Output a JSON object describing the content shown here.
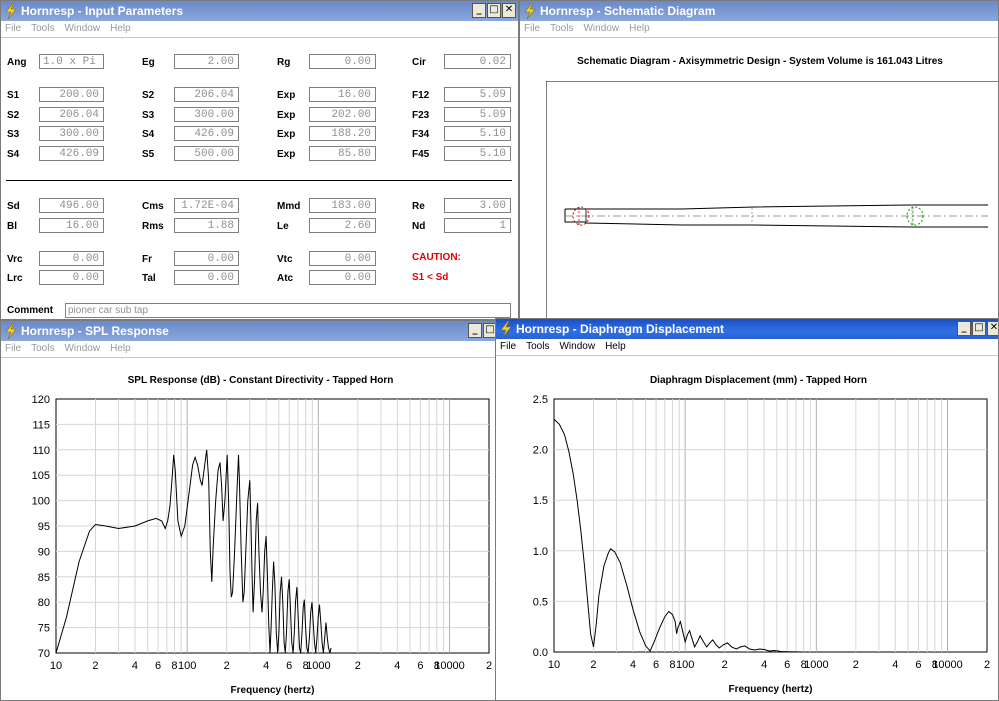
{
  "input_window": {
    "title": "Hornresp - Input Parameters",
    "menu": [
      "File",
      "Tools",
      "Window",
      "Help"
    ],
    "controls": [
      "_",
      "□",
      "✕"
    ],
    "rows": [
      [
        {
          "label": "Ang",
          "value": "1.0 x Pi"
        },
        {
          "label": "Eg",
          "value": "2.00"
        },
        {
          "label": "Rg",
          "value": "0.00"
        },
        {
          "label": "Cir",
          "value": "0.02"
        }
      ],
      [
        {
          "label": "S1",
          "value": "200.00"
        },
        {
          "label": "S2",
          "value": "206.04"
        },
        {
          "label": "Exp",
          "value": "16.00"
        },
        {
          "label": "F12",
          "value": "5.09"
        }
      ],
      [
        {
          "label": "S2",
          "value": "206.04"
        },
        {
          "label": "S3",
          "value": "300.00"
        },
        {
          "label": "Exp",
          "value": "202.00"
        },
        {
          "label": "F23",
          "value": "5.09"
        }
      ],
      [
        {
          "label": "S3",
          "value": "300.00"
        },
        {
          "label": "S4",
          "value": "426.09"
        },
        {
          "label": "Exp",
          "value": "188.20"
        },
        {
          "label": "F34",
          "value": "5.10"
        }
      ],
      [
        {
          "label": "S4",
          "value": "426.09"
        },
        {
          "label": "S5",
          "value": "500.00"
        },
        {
          "label": "Exp",
          "value": "85.80"
        },
        {
          "label": "F45",
          "value": "5.10"
        }
      ],
      [
        {
          "label": "Sd",
          "value": "496.00"
        },
        {
          "label": "Cms",
          "value": "1.72E-04"
        },
        {
          "label": "Mmd",
          "value": "183.00"
        },
        {
          "label": "Re",
          "value": "3.00"
        }
      ],
      [
        {
          "label": "Bl",
          "value": "16.00"
        },
        {
          "label": "Rms",
          "value": "1.88"
        },
        {
          "label": "Le",
          "value": "2.60"
        },
        {
          "label": "Nd",
          "value": "1"
        }
      ],
      [
        {
          "label": "Vrc",
          "value": "0.00"
        },
        {
          "label": "Fr",
          "value": "0.00"
        },
        {
          "label": "Vtc",
          "value": "0.00"
        }
      ],
      [
        {
          "label": "Lrc",
          "value": "0.00"
        },
        {
          "label": "Tal",
          "value": "0.00"
        },
        {
          "label": "Atc",
          "value": "0.00"
        }
      ]
    ],
    "caution_title": "CAUTION:",
    "caution_text": "S1 < Sd",
    "comment_label": "Comment",
    "comment_value": "pioner car sub tap",
    "colors": {
      "caution": "#e00000"
    }
  },
  "schematic_window": {
    "title": "Hornresp - Schematic Diagram",
    "menu": [
      "File",
      "Tools",
      "Window",
      "Help"
    ],
    "heading": "Schematic Diagram - Axisymmetric Design - System Volume is 161.043 Litres"
  },
  "spl_window": {
    "title": "Hornresp - SPL Response",
    "menu": [
      "File",
      "Tools",
      "Window",
      "Help"
    ],
    "controls": [
      "_",
      "□"
    ]
  },
  "disp_window": {
    "title": "Hornresp - Diaphragm Displacement",
    "menu": [
      "File",
      "Tools",
      "Window",
      "Help"
    ],
    "controls": [
      "_",
      "□",
      "✕"
    ]
  },
  "chart_data": [
    {
      "type": "line",
      "title": "SPL Response (dB) - Constant Directivity - Tapped Horn",
      "xlabel": "Frequency (hertz)",
      "ylabel": "",
      "xscale": "log",
      "xlim": [
        10,
        20000
      ],
      "ylim": [
        70,
        120
      ],
      "yticks": [
        70,
        75,
        80,
        85,
        90,
        95,
        100,
        105,
        110,
        115,
        120
      ],
      "xtick_labels": [
        {
          "x": 10,
          "t": "10"
        },
        {
          "x": 20,
          "t": "2"
        },
        {
          "x": 40,
          "t": "4"
        },
        {
          "x": 60,
          "t": "6"
        },
        {
          "x": 80,
          "t": "8"
        },
        {
          "x": 100,
          "t": "100"
        },
        {
          "x": 200,
          "t": "2"
        },
        {
          "x": 400,
          "t": "4"
        },
        {
          "x": 600,
          "t": "6"
        },
        {
          "x": 800,
          "t": "8"
        },
        {
          "x": 1000,
          "t": "1000"
        },
        {
          "x": 2000,
          "t": "2"
        },
        {
          "x": 4000,
          "t": "4"
        },
        {
          "x": 6000,
          "t": "6"
        },
        {
          "x": 8000,
          "t": "8"
        },
        {
          "x": 10000,
          "t": "10000"
        },
        {
          "x": 20000,
          "t": "2"
        }
      ],
      "grid": true,
      "series": [
        {
          "values": [
            [
              10,
              70
            ],
            [
              12,
              77
            ],
            [
              15,
              88
            ],
            [
              18,
              94
            ],
            [
              20,
              95.3
            ],
            [
              24,
              95
            ],
            [
              30,
              94.5
            ],
            [
              40,
              95
            ],
            [
              50,
              96
            ],
            [
              58,
              96.5
            ],
            [
              64,
              96
            ],
            [
              68,
              94.5
            ],
            [
              71,
              96
            ],
            [
              74,
              99
            ],
            [
              77,
              105
            ],
            [
              79,
              109
            ],
            [
              81,
              106
            ],
            [
              85,
              96
            ],
            [
              90,
              93
            ],
            [
              96,
              95
            ],
            [
              104,
              102
            ],
            [
              110,
              107
            ],
            [
              115,
              108.5
            ],
            [
              120,
              107
            ],
            [
              126,
              104
            ],
            [
              130,
              103
            ],
            [
              136,
              107
            ],
            [
              141,
              110
            ],
            [
              146,
              104
            ],
            [
              150,
              90
            ],
            [
              154,
              84
            ],
            [
              158,
              91
            ],
            [
              165,
              100
            ],
            [
              172,
              106
            ],
            [
              178,
              107.5
            ],
            [
              183,
              103
            ],
            [
              188,
              96
            ],
            [
              194,
              100
            ],
            [
              202,
              109
            ],
            [
              207,
              100
            ],
            [
              212,
              86
            ],
            [
              217,
              81
            ],
            [
              222,
              82
            ],
            [
              230,
              90
            ],
            [
              240,
              102
            ],
            [
              246,
              109
            ],
            [
              250,
              104
            ],
            [
              258,
              90
            ],
            [
              266,
              80
            ],
            [
              272,
              82
            ],
            [
              280,
              90
            ],
            [
              290,
              100
            ],
            [
              300,
              104
            ],
            [
              306,
              96
            ],
            [
              312,
              86
            ],
            [
              318,
              78
            ],
            [
              326,
              84
            ],
            [
              336,
              96
            ],
            [
              344,
              99.5
            ],
            [
              352,
              90
            ],
            [
              362,
              82
            ],
            [
              372,
              78
            ],
            [
              380,
              82
            ],
            [
              390,
              90
            ],
            [
              400,
              93
            ],
            [
              408,
              86
            ],
            [
              418,
              76
            ],
            [
              428,
              70
            ],
            [
              436,
              75
            ],
            [
              446,
              82
            ],
            [
              456,
              88
            ],
            [
              466,
              84
            ],
            [
              478,
              74
            ],
            [
              490,
              70
            ],
            [
              500,
              74
            ],
            [
              512,
              82
            ],
            [
              524,
              85
            ],
            [
              536,
              80
            ],
            [
              548,
              72
            ],
            [
              560,
              70
            ],
            [
              572,
              74
            ],
            [
              586,
              82
            ],
            [
              600,
              84.5
            ],
            [
              614,
              78
            ],
            [
              628,
              72
            ],
            [
              642,
              70
            ],
            [
              656,
              74
            ],
            [
              670,
              80
            ],
            [
              686,
              83
            ],
            [
              702,
              77
            ],
            [
              718,
              71
            ],
            [
              734,
              70
            ],
            [
              750,
              74
            ],
            [
              766,
              79
            ],
            [
              782,
              80.5
            ],
            [
              800,
              75
            ],
            [
              818,
              71
            ],
            [
              836,
              70
            ],
            [
              854,
              73
            ],
            [
              874,
              78
            ],
            [
              894,
              80
            ],
            [
              914,
              76
            ],
            [
              934,
              72
            ],
            [
              954,
              70
            ],
            [
              976,
              73
            ],
            [
              998,
              77
            ],
            [
              1020,
              79.5
            ],
            [
              1044,
              76
            ],
            [
              1068,
              72
            ],
            [
              1092,
              70
            ],
            [
              1118,
              73
            ],
            [
              1144,
              76
            ],
            [
              1170,
              73
            ],
            [
              1196,
              71
            ],
            [
              1224,
              70
            ],
            [
              1250,
              71
            ]
          ]
        }
      ]
    },
    {
      "type": "line",
      "title": "Diaphragm Displacement (mm) - Tapped Horn",
      "xlabel": "Frequency (hertz)",
      "ylabel": "",
      "xscale": "log",
      "xlim": [
        10,
        20000
      ],
      "ylim": [
        0,
        2.5
      ],
      "yticks": [
        0.0,
        0.5,
        1.0,
        1.5,
        2.0,
        2.5
      ],
      "ytick_labels": [
        "0.0",
        "0.5",
        "1.0",
        "1.5",
        "2.0",
        "2.5"
      ],
      "xtick_labels": [
        {
          "x": 10,
          "t": "10"
        },
        {
          "x": 20,
          "t": "2"
        },
        {
          "x": 40,
          "t": "4"
        },
        {
          "x": 60,
          "t": "6"
        },
        {
          "x": 80,
          "t": "8"
        },
        {
          "x": 100,
          "t": "100"
        },
        {
          "x": 200,
          "t": "2"
        },
        {
          "x": 400,
          "t": "4"
        },
        {
          "x": 600,
          "t": "6"
        },
        {
          "x": 800,
          "t": "8"
        },
        {
          "x": 1000,
          "t": "1000"
        },
        {
          "x": 2000,
          "t": "2"
        },
        {
          "x": 4000,
          "t": "4"
        },
        {
          "x": 6000,
          "t": "6"
        },
        {
          "x": 8000,
          "t": "8"
        },
        {
          "x": 10000,
          "t": "10000"
        },
        {
          "x": 20000,
          "t": "2"
        }
      ],
      "grid": true,
      "series": [
        {
          "values": [
            [
              10,
              2.3
            ],
            [
              11,
              2.25
            ],
            [
              12,
              2.15
            ],
            [
              13,
              1.98
            ],
            [
              14,
              1.76
            ],
            [
              15,
              1.5
            ],
            [
              16,
              1.2
            ],
            [
              17,
              0.88
            ],
            [
              18,
              0.52
            ],
            [
              19,
              0.18
            ],
            [
              20,
              0.05
            ],
            [
              21,
              0.28
            ],
            [
              22,
              0.56
            ],
            [
              24,
              0.85
            ],
            [
              26,
              0.98
            ],
            [
              27,
              1.02
            ],
            [
              29,
              0.99
            ],
            [
              32,
              0.88
            ],
            [
              36,
              0.65
            ],
            [
              40,
              0.42
            ],
            [
              45,
              0.2
            ],
            [
              50,
              0.06
            ],
            [
              54,
              0.01
            ],
            [
              58,
              0.1
            ],
            [
              64,
              0.24
            ],
            [
              70,
              0.35
            ],
            [
              75,
              0.4
            ],
            [
              80,
              0.37
            ],
            [
              84,
              0.3
            ],
            [
              86,
              0.18
            ],
            [
              88,
              0.24
            ],
            [
              92,
              0.3
            ],
            [
              96,
              0.2
            ],
            [
              100,
              0.1
            ],
            [
              104,
              0.17
            ],
            [
              108,
              0.21
            ],
            [
              113,
              0.13
            ],
            [
              118,
              0.05
            ],
            [
              124,
              0.1
            ],
            [
              130,
              0.16
            ],
            [
              138,
              0.1
            ],
            [
              146,
              0.05
            ],
            [
              154,
              0.09
            ],
            [
              162,
              0.12
            ],
            [
              172,
              0.07
            ],
            [
              182,
              0.04
            ],
            [
              195,
              0.07
            ],
            [
              210,
              0.09
            ],
            [
              226,
              0.05
            ],
            [
              245,
              0.03
            ],
            [
              265,
              0.05
            ],
            [
              285,
              0.06
            ],
            [
              310,
              0.03
            ],
            [
              340,
              0.02
            ],
            [
              370,
              0.03
            ],
            [
              400,
              0.025
            ],
            [
              440,
              0.01
            ],
            [
              480,
              0.015
            ],
            [
              540,
              0.005
            ],
            [
              600,
              0.003
            ],
            [
              700,
              0.001
            ],
            [
              800,
              0
            ]
          ]
        }
      ]
    }
  ]
}
